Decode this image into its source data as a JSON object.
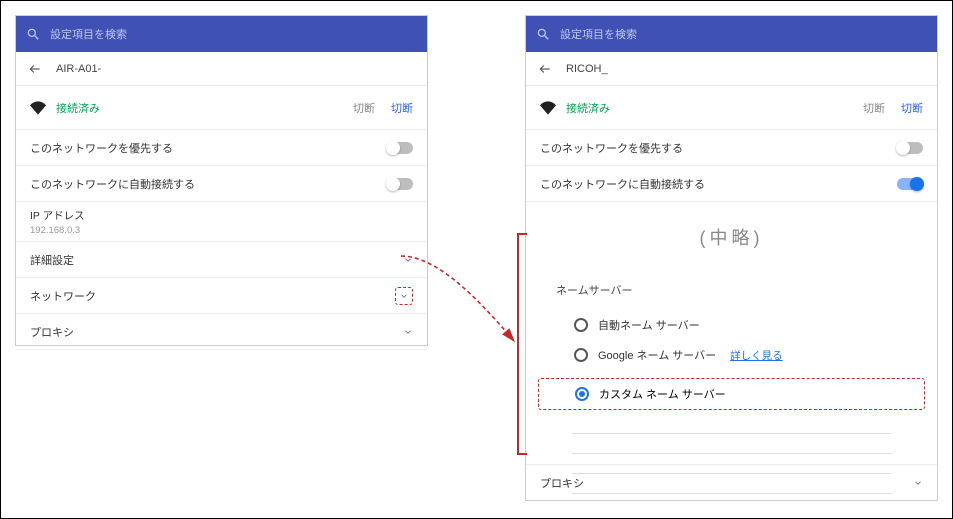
{
  "search_placeholder": "設定項目を検索",
  "left": {
    "breadcrumb": "AIR-A01-",
    "status": "接続済み",
    "disconnect1": "切断",
    "disconnect2": "切断",
    "prefer_net": "このネットワークを優先する",
    "auto_connect": "このネットワークに自動接続する",
    "ip_label": "IP アドレス",
    "ip_value": "192.168.0.3",
    "rows": {
      "detail": "詳細設定",
      "network": "ネットワーク",
      "proxy": "プロキシ"
    }
  },
  "right": {
    "breadcrumb": "RICOH_",
    "status": "接続済み",
    "disconnect1": "切断",
    "disconnect2": "切断",
    "prefer_net": "このネットワークを優先する",
    "auto_connect": "このネットワークに自動接続する",
    "omitted": "(中略)",
    "ns_title": "ネームサーバー",
    "ns_options": {
      "auto": "自動ネーム サーバー",
      "google": "Google ネーム サーバー",
      "google_link": "詳しく見る",
      "custom": "カスタム ネーム サーバー"
    },
    "proxy": "プロキシ"
  }
}
